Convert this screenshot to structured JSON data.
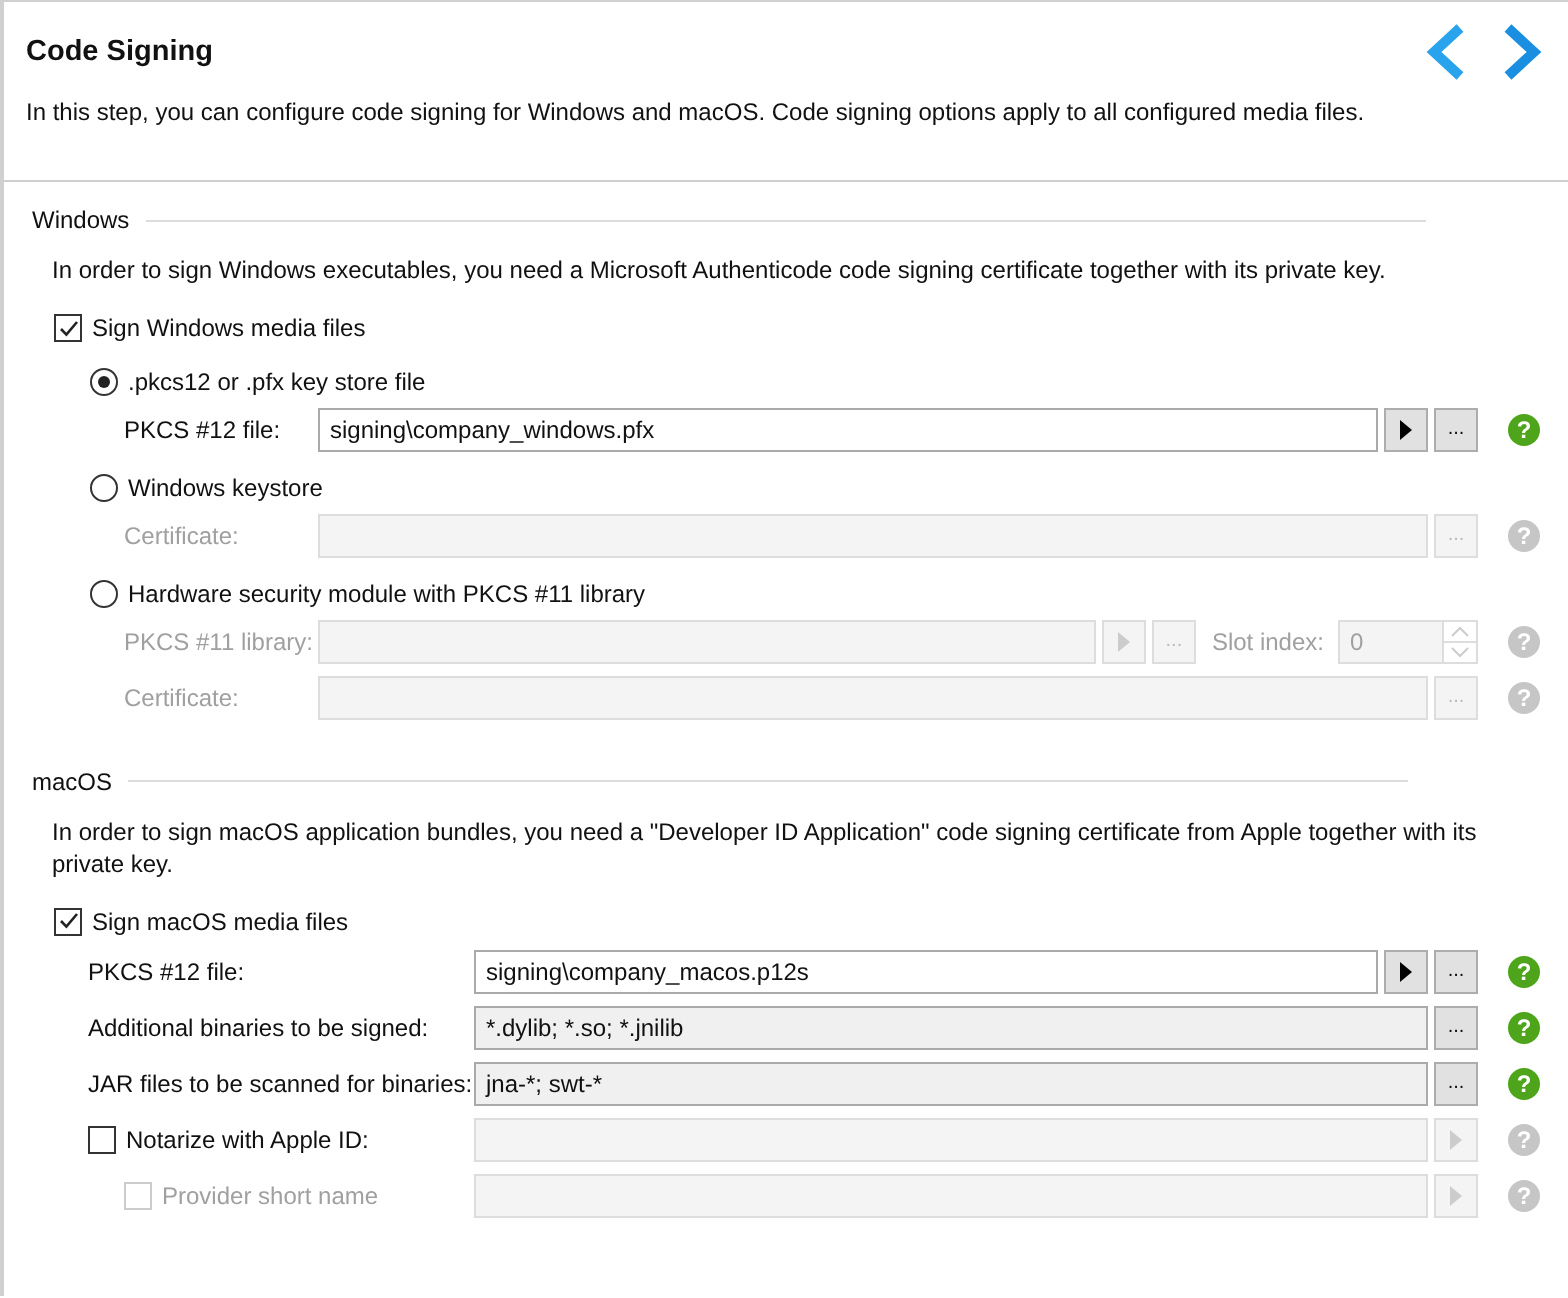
{
  "header": {
    "title": "Code Signing",
    "description": "In this step, you can configure code signing for Windows and macOS. Code signing options apply to all configured media files."
  },
  "windows": {
    "title": "Windows",
    "description": "In order to sign Windows executables, you need a Microsoft Authenticode code signing certificate together with its private key.",
    "checkbox": {
      "label": "Sign Windows media files",
      "checked": true
    },
    "options": [
      {
        "label": ".pkcs12 or .pfx key store file",
        "selected": true,
        "fields": [
          {
            "label": "PKCS #12 file:",
            "value": "signing\\company_windows.pfx",
            "disabled": false,
            "buttons": [
              {
                "kind": "arrow"
              },
              {
                "kind": "browse",
                "label": "..."
              }
            ],
            "help": "?"
          }
        ]
      },
      {
        "label": "Windows keystore",
        "selected": false,
        "fields": [
          {
            "label": "Certificate:",
            "disabled": true,
            "buttons": [
              {
                "kind": "browse",
                "label": "..."
              }
            ],
            "help": "?"
          }
        ]
      },
      {
        "label": "Hardware security module with PKCS #11 library",
        "selected": false,
        "fields": [
          {
            "label": "PKCS #11 library:",
            "disabled": true,
            "buttons": [
              {
                "kind": "arrow"
              },
              {
                "kind": "browse",
                "label": "..."
              }
            ],
            "slot": {
              "label": "Slot index:",
              "value": "0"
            },
            "help": "?"
          },
          {
            "label": "Certificate:",
            "disabled": true,
            "buttons": [
              {
                "kind": "browse",
                "label": "..."
              }
            ],
            "help": "?"
          }
        ]
      }
    ]
  },
  "macos": {
    "title": "macOS",
    "description": "In order to sign macOS application bundles, you need a \"Developer ID Application\" code signing certificate from Apple together with its private key.",
    "checkbox": {
      "label": "Sign macOS media files",
      "checked": true
    },
    "rows": [
      {
        "kind": "field",
        "label": "PKCS #12 file:",
        "value": "signing\\company_macos.p12s",
        "disabled": false,
        "readonly": false,
        "buttons": [
          {
            "kind": "arrow"
          },
          {
            "kind": "browse",
            "label": "..."
          }
        ],
        "help": "?"
      },
      {
        "kind": "field",
        "label": "Additional binaries to be signed:",
        "value": "*.dylib; *.so; *.jnilib",
        "disabled": false,
        "readonly": true,
        "buttons": [
          {
            "kind": "browse",
            "label": "..."
          }
        ],
        "help": "?"
      },
      {
        "kind": "field",
        "label": "JAR files to be scanned for binaries:",
        "value": "jna-*; swt-*",
        "disabled": false,
        "readonly": true,
        "buttons": [
          {
            "kind": "browse",
            "label": "..."
          }
        ],
        "help": "?"
      },
      {
        "kind": "checkbox",
        "label": "Notarize with Apple ID:",
        "checked": false,
        "disabled": false,
        "field_disabled": true,
        "buttons": [
          {
            "kind": "arrow"
          }
        ],
        "help": "?",
        "children": [
          {
            "kind": "checkbox",
            "label": "Provider short name",
            "checked": false,
            "disabled": true,
            "field_disabled": true,
            "buttons": [
              {
                "kind": "arrow"
              }
            ],
            "help": "?"
          }
        ]
      }
    ]
  }
}
